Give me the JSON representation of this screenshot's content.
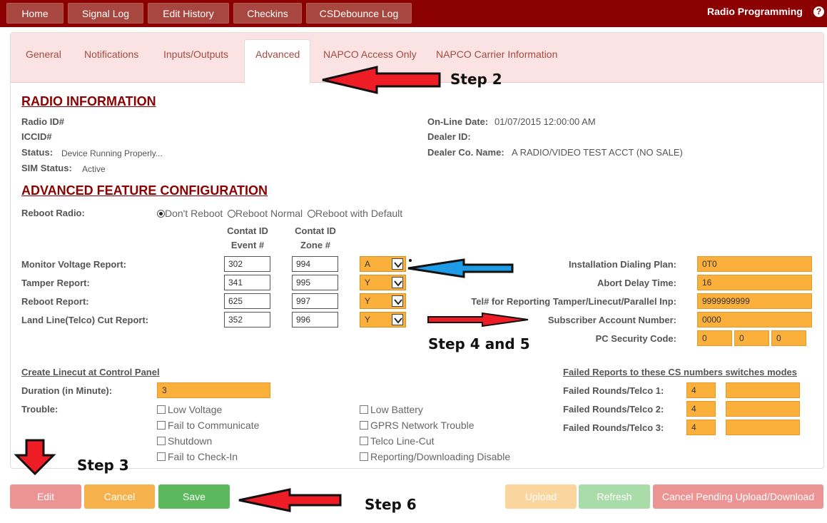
{
  "topnav": {
    "items": [
      "Home",
      "Signal Log",
      "Edit History",
      "Checkins",
      "CSDebounce Log"
    ],
    "title": "Radio Programming",
    "help": "?"
  },
  "tabs": [
    "General",
    "Notifications",
    "Inputs/Outputs",
    "Advanced",
    "NAPCO Access Only",
    "NAPCO Carrier Information"
  ],
  "active_tab": "Advanced",
  "radio_info": {
    "heading": "RADIO INFORMATION",
    "radio_id_label": "Radio ID#",
    "iccid_label": "ICCID#",
    "status_label": "Status:",
    "status_value": "Device Running Properly...",
    "sim_label": "SIM Status:",
    "sim_value": "Active",
    "online_label": "On-Line Date:",
    "online_value": "01/07/2015 12:00:00 AM",
    "dealer_id_label": "Dealer ID:",
    "dealer_name_label": "Dealer Co. Name:",
    "dealer_name_value": "A RADIO/VIDEO TEST ACCT (NO SALE)"
  },
  "advanced": {
    "heading": "ADVANCED FEATURE CONFIGURATION",
    "reboot_label": "Reboot Radio:",
    "reboot_options": [
      "Don't Reboot",
      "Reboot Normal",
      "Reboot with Default"
    ],
    "reboot_selected": "Don't Reboot",
    "col1_line1": "Contat ID",
    "col1_line2": "Event #",
    "col2_line1": "Contat ID",
    "col2_line2": "Zone #",
    "reports": [
      {
        "label": "Monitor Voltage Report:",
        "event": "302",
        "zone": "994",
        "select": "A"
      },
      {
        "label": "Tamper Report:",
        "event": "341",
        "zone": "995",
        "select": "Y"
      },
      {
        "label": "Reboot Report:",
        "event": "625",
        "zone": "997",
        "select": "Y"
      },
      {
        "label": "Land Line(Telco) Cut Report:",
        "event": "352",
        "zone": "996",
        "select": "Y"
      }
    ],
    "right_fields": [
      {
        "label": "Installation Dialing Plan:",
        "value": "0T0"
      },
      {
        "label": "Abort Delay Time:",
        "value": "16"
      },
      {
        "label": "Tel# for Reporting Tamper/Linecut/Parallel Inp:",
        "value": "9999999999"
      },
      {
        "label": "Subscriber Account Number:",
        "value": "0000"
      }
    ],
    "pc_security_label": "PC Security Code:",
    "pc_security_values": [
      "0",
      "0",
      "0"
    ]
  },
  "linecut": {
    "heading": "Create Linecut at Control Panel",
    "duration_label": "Duration (in Minute):",
    "duration_value": "3",
    "trouble_label": "Trouble:",
    "trouble_left": [
      "Low Voltage",
      "Fail to Communicate",
      "Shutdown",
      "Fail to Check-In"
    ],
    "trouble_right": [
      "Low Battery",
      "GPRS Network Trouble",
      "Telco Line-Cut",
      "Reporting/Downloading Disable"
    ]
  },
  "failed": {
    "heading": "Failed Reports to these CS numbers switches modes",
    "rows": [
      {
        "label": "Failed Rounds/Telco 1:",
        "value": "4",
        "extra": ""
      },
      {
        "label": "Failed Rounds/Telco 2:",
        "value": "4",
        "extra": ""
      },
      {
        "label": "Failed Rounds/Telco 3:",
        "value": "4",
        "extra": ""
      }
    ]
  },
  "buttons": {
    "edit": "Edit",
    "cancel": "Cancel",
    "save": "Save",
    "upload": "Upload",
    "refresh": "Refresh",
    "cancel_pending": "Cancel Pending Upload/Download"
  },
  "annotations": {
    "step2": "Step 2",
    "step3": "Step 3",
    "step45": "Step 4 and 5",
    "step6": "Step 6"
  },
  "colors": {
    "topbar": "#8b0000",
    "accent_orange": "#fbb03b",
    "save_green": "#5cb85c",
    "arrow_red": "#ee1c24",
    "arrow_blue": "#1e9be6"
  }
}
